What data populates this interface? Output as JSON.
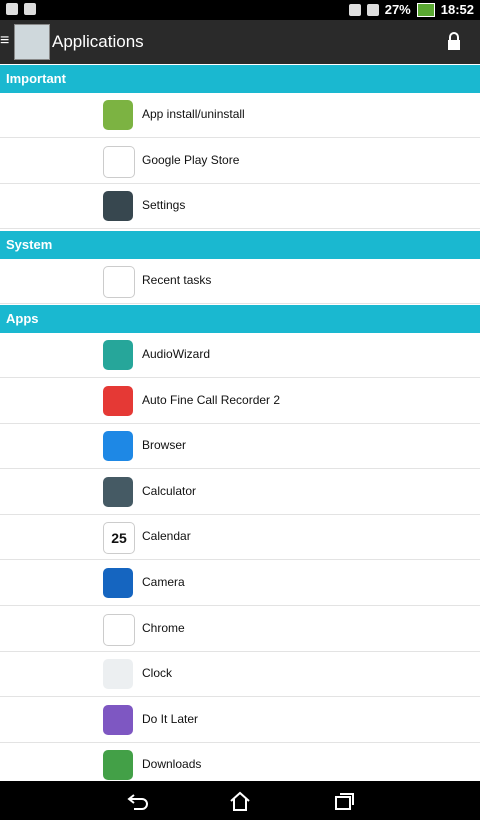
{
  "status_bar": {
    "battery": "27%",
    "time": "18:52"
  },
  "app_bar": {
    "title": "Applications"
  },
  "sections": [
    {
      "title": "Important",
      "items": [
        {
          "label": "App install/uninstall",
          "icon": "android-installer-icon",
          "color": "#7cb342"
        },
        {
          "label": "Google Play Store",
          "icon": "play-store-icon",
          "color": "#ffffff"
        },
        {
          "label": "Settings",
          "icon": "gear-icon",
          "color": "#37474f"
        }
      ]
    },
    {
      "title": "System",
      "items": [
        {
          "label": "Recent tasks",
          "icon": "android-logo-icon",
          "color": "#ffffff"
        }
      ]
    },
    {
      "title": "Apps",
      "items": [
        {
          "label": "AudioWizard",
          "icon": "equalizer-icon",
          "color": "#26a69a"
        },
        {
          "label": "Auto Fine Call Recorder 2",
          "icon": "call-recorder-icon",
          "color": "#e53935"
        },
        {
          "label": "Browser",
          "icon": "globe-icon",
          "color": "#1e88e5"
        },
        {
          "label": "Calculator",
          "icon": "calculator-icon",
          "color": "#455a64"
        },
        {
          "label": "Calendar",
          "icon": "calendar-icon",
          "color": "#ffffff",
          "text": "25"
        },
        {
          "label": "Camera",
          "icon": "camera-icon",
          "color": "#1565c0"
        },
        {
          "label": "Chrome",
          "icon": "chrome-icon",
          "color": "#ffffff"
        },
        {
          "label": "Clock",
          "icon": "clock-icon",
          "color": "#eceff1"
        },
        {
          "label": "Do It Later",
          "icon": "checkmark-icon",
          "color": "#7e57c2"
        },
        {
          "label": "Downloads",
          "icon": "download-icon",
          "color": "#43a047"
        }
      ]
    }
  ]
}
